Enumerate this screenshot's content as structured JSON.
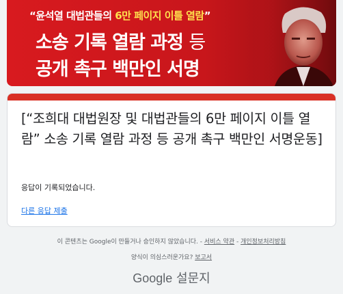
{
  "banner": {
    "quote_open": "“",
    "quote_name": "윤석열 대법관",
    "quote_mid": "들의 ",
    "quote_highlight": "6만 페이지 이틀 열람",
    "quote_close": "”",
    "line2_main": "소송 기록 열람 과정 ",
    "line2_suffix": "등",
    "line3": "공개 촉구 백만인 서명",
    "colors": {
      "background": "#d81a1f",
      "highlight": "#ffe14d"
    }
  },
  "form": {
    "title": "[“조희대 대법원장 및 대법관들의 6만 페이지 이틀 열람” 소송 기록 열람 과정 등 공개 촉구 백만인 서명운동]",
    "status": "응답이 기록되었습니다.",
    "another_response_link": "다른 응답 제출",
    "accent_color": "#d93025"
  },
  "footer": {
    "notice": "이 콘텐츠는 Google이 만들거나 승인하지 않았습니다. - ",
    "terms_link": "서비스 약관",
    "separator": " - ",
    "privacy_link": "개인정보처리방침",
    "suspicious_text": "양식이 의심스러운가요? ",
    "report_link": "보고서",
    "logo_google": "Google",
    "logo_forms": " 설문지"
  }
}
